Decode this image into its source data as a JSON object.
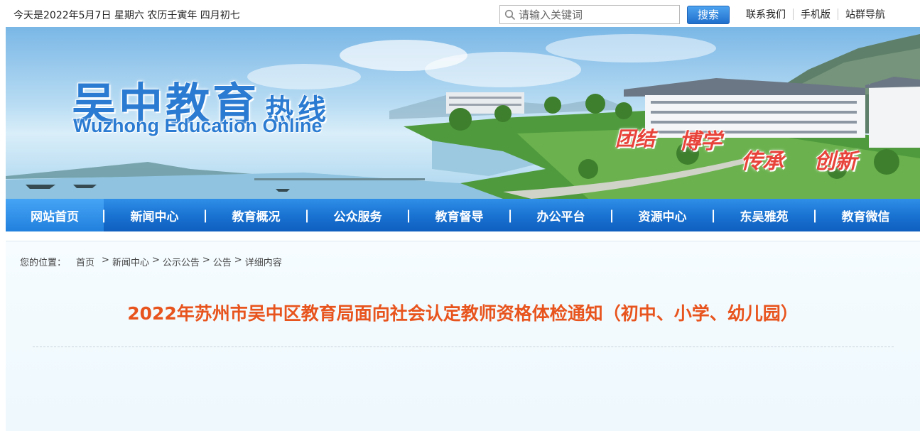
{
  "topbar": {
    "date_text": "今天是2022年5月7日 星期六 农历壬寅年 四月初七",
    "search_placeholder": "请输入关键词",
    "search_button": "搜索",
    "links": [
      "联系我们",
      "手机版",
      "站群导航"
    ]
  },
  "banner": {
    "logo_cn_main": "吴中教育",
    "logo_cn_sub": "热线",
    "logo_en": "Wuzhong Education Online",
    "motto": [
      "团结",
      "博学",
      "传承",
      "创新"
    ],
    "colors": {
      "logo": "#2a7bd1",
      "motto": "#e8433a"
    }
  },
  "nav": {
    "items": [
      "网站首页",
      "新闻中心",
      "教育概况",
      "公众服务",
      "教育督导",
      "办公平台",
      "资源中心",
      "东吴雅苑",
      "教育微信"
    ],
    "active_index": 0,
    "separator": "|"
  },
  "breadcrumb": {
    "label": "您的位置：",
    "items": [
      "首页",
      "新闻中心",
      "公示公告",
      "公告",
      "详细内容"
    ],
    "separator": ">"
  },
  "article": {
    "title": "2022年苏州市吴中区教育局面向社会认定教师资格体检通知（初中、小学、幼儿园）",
    "title_color": "#e8541d"
  }
}
